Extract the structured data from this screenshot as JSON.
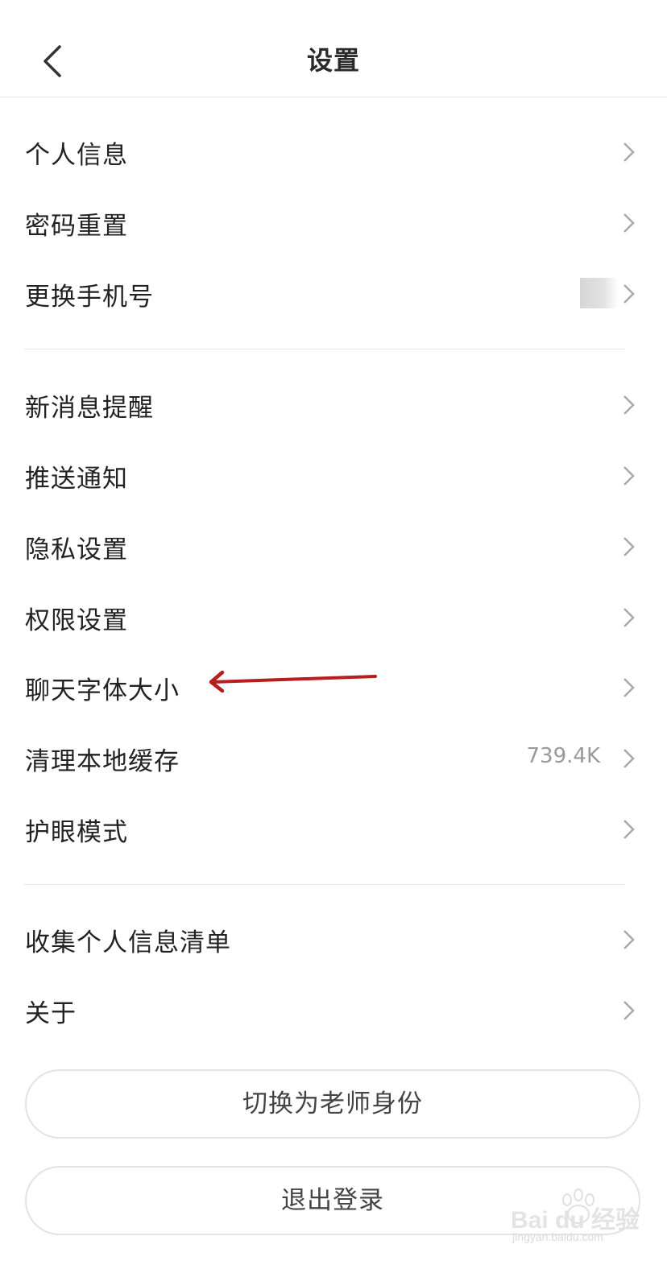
{
  "header": {
    "title": "设置",
    "back_icon": "chevron-left-icon"
  },
  "settings": {
    "group1": [
      {
        "label": "个人信息"
      },
      {
        "label": "密码重置"
      },
      {
        "label": "更换手机号"
      }
    ],
    "group2": [
      {
        "label": "新消息提醒"
      },
      {
        "label": "推送通知"
      },
      {
        "label": "隐私设置"
      },
      {
        "label": "权限设置"
      },
      {
        "label": "聊天字体大小"
      },
      {
        "label": "清理本地缓存",
        "value": "739.4K"
      },
      {
        "label": "护眼模式"
      }
    ],
    "group3": [
      {
        "label": "收集个人信息清单"
      },
      {
        "label": "关于"
      }
    ]
  },
  "buttons": {
    "switch_role": "切换为老师身份",
    "logout": "退出登录"
  },
  "annotation": {
    "arrow_color": "#b81c1c"
  },
  "watermark": {
    "brand": "Bai du 经验",
    "url": "jingyan.baidu.com"
  },
  "colors": {
    "text": "#222222",
    "secondary_text": "#999999",
    "divider": "#e6e6e6",
    "chevron": "#aaaaaa"
  }
}
